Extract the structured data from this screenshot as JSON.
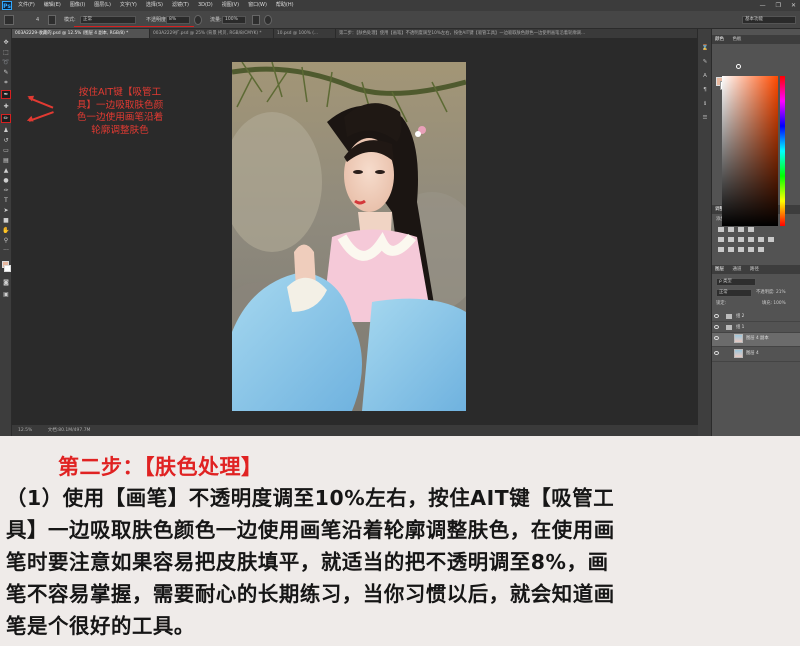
{
  "app": {
    "logo": "Ps",
    "menu": [
      "文件(F)",
      "编辑(E)",
      "图像(I)",
      "图层(L)",
      "文字(Y)",
      "选择(S)",
      "滤镜(T)",
      "3D(D)",
      "视图(V)",
      "窗口(W)",
      "帮助(H)"
    ],
    "workspace": "基本功能"
  },
  "options": {
    "brush_size": "4",
    "mode_label": "模式:",
    "mode_value": "正常",
    "opacity_label": "不透明度:",
    "opacity_value": "8%",
    "flow_label": "流量:",
    "flow_value": "100%"
  },
  "doc_tabs": [
    "003A2229-收藏的.psd @ 12.5% (图层 4 副本, RGB/8) *",
    "003A2229扩.psd @ 25% (背景 拷贝, RGB/8/CMYK) *",
    "10.psd @ 100% (...",
    "第二步：【肤色处理】使用【画笔】不透明度调至10%左右，按住AIT键【吸管工具】一边吸取肤色颜色一边使用画笔沿着轮廓调..."
  ],
  "status": {
    "zoom": "12.5%",
    "doc": "文档:80.1M/497.7M"
  },
  "annotation": [
    "按住AIT键【吸管工",
    "具】一边吸取肤色颜",
    "色一边使用画笔沿着",
    "轮廓调整肤色"
  ],
  "panels": {
    "color_tabs": [
      "颜色",
      "色板"
    ],
    "adjust_tabs": [
      "调整",
      "样式"
    ],
    "adjust_title": "添加调整",
    "layer_tabs": [
      "图层",
      "通道",
      "路径"
    ],
    "kind_label": "ρ 类型",
    "blend_mode": "正常",
    "layer_opacity": "不透明度: 21%",
    "lock_label": "锁定:",
    "fill_label": "填充: 100%",
    "layers": [
      "组 2",
      "组 1",
      "图层 4 副本",
      "图层 4"
    ]
  },
  "colors": {
    "accent_red": "#e02222",
    "foreground": "#e8b9a1"
  },
  "tutorial": {
    "step_title": "第二步：【肤色处理】",
    "lines": [
      "（1）使用【画笔】不透明度调至10%左右，按住AIT键【吸管工",
      "具】一边吸取肤色颜色一边使用画笔沿着轮廓调整肤色，在使用画",
      "笔时要注意如果容易把皮肤填平，就适当的把不透明调至8%，画",
      "笔不容易掌握，需要耐心的长期练习，当你习惯以后，就会知道画",
      "笔是个很好的工具。"
    ]
  }
}
